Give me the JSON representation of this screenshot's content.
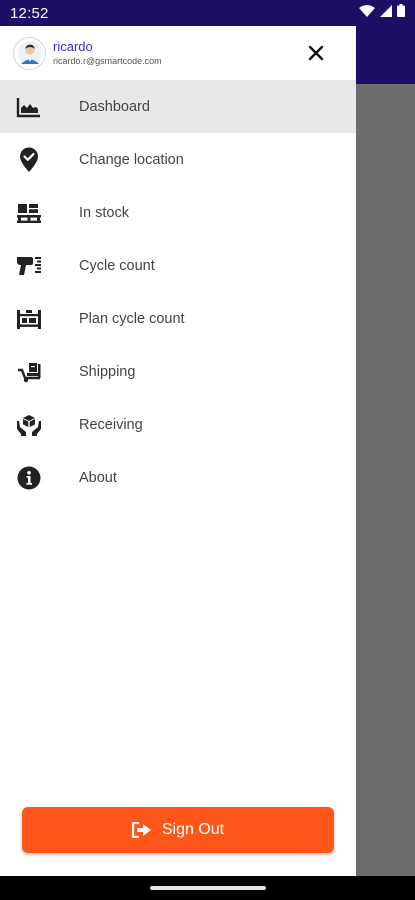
{
  "status_bar": {
    "time": "12:52",
    "icons": [
      "wifi-icon",
      "signal-icon",
      "battery-icon"
    ]
  },
  "drawer": {
    "user": {
      "name": "ricardo",
      "email": "ricardo.r@gsmartcode.com",
      "avatar_icon": "user-avatar-icon"
    },
    "close_icon": "close-icon",
    "menu": [
      {
        "label": "Dashboard",
        "icon": "dashboard-chart-icon",
        "active": true
      },
      {
        "label": "Change location",
        "icon": "location-check-icon",
        "active": false
      },
      {
        "label": "In stock",
        "icon": "pallet-boxes-icon",
        "active": false
      },
      {
        "label": "Cycle count",
        "icon": "barcode-scanner-icon",
        "active": false
      },
      {
        "label": "Plan cycle count",
        "icon": "pallet-rack-icon",
        "active": false
      },
      {
        "label": "Shipping",
        "icon": "dolly-icon",
        "active": false
      },
      {
        "label": "Receiving",
        "icon": "hands-box-icon",
        "active": false
      },
      {
        "label": "About",
        "icon": "info-icon",
        "active": false
      }
    ],
    "sign_out": {
      "label": "Sign Out",
      "icon": "sign-out-icon"
    }
  },
  "colors": {
    "primary": "#1b0f66",
    "accent": "#ff5719",
    "user_name": "#3c2bd6",
    "active_item": "#e8e8e8",
    "scrim": "#6b6b6b"
  }
}
